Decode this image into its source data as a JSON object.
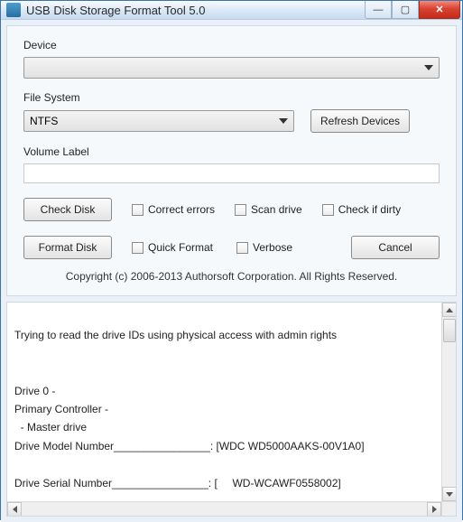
{
  "window": {
    "title": "USB Disk Storage Format Tool 5.0"
  },
  "labels": {
    "device": "Device",
    "file_system": "File System",
    "volume_label": "Volume Label"
  },
  "fields": {
    "device_value": "",
    "file_system_value": "NTFS",
    "volume_label_value": ""
  },
  "buttons": {
    "refresh": "Refresh Devices",
    "check_disk": "Check Disk",
    "format_disk": "Format Disk",
    "cancel": "Cancel"
  },
  "checks": {
    "correct_errors": "Correct errors",
    "scan_drive": "Scan drive",
    "check_if_dirty": "Check if dirty",
    "quick_format": "Quick Format",
    "verbose": "Verbose"
  },
  "footer": {
    "copyright": "Copyright (c) 2006-2013 Authorsoft Corporation. All Rights Reserved."
  },
  "log": {
    "line1": "Trying to read the drive IDs using physical access with admin rights",
    "blank": "",
    "line2": "Drive 0 -",
    "line3": "Primary Controller -",
    "line4": "  - Master drive",
    "line5": "Drive Model Number________________: [WDC WD5000AAKS-00V1A0]",
    "line6": "Drive Serial Number________________: [     WD-WCAWF0558002]"
  }
}
